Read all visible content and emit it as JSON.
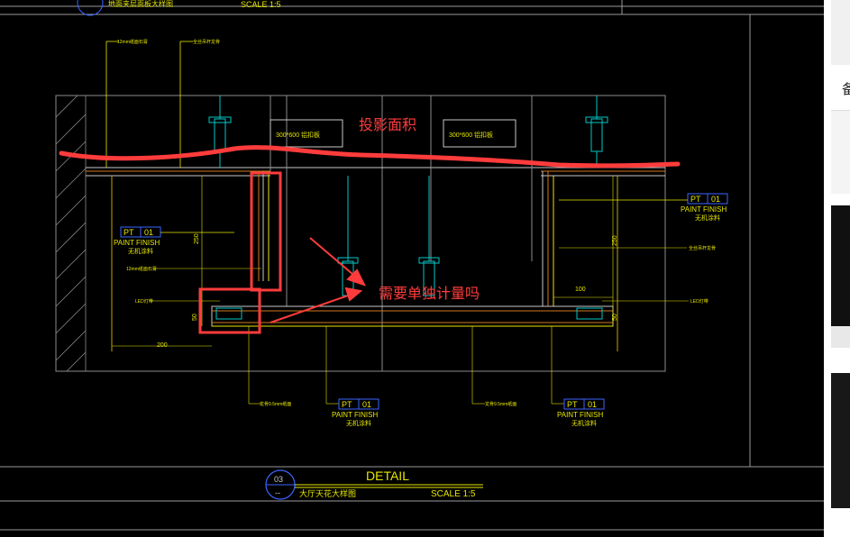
{
  "drawing": {
    "top_caption": "地面夹层面板大样图",
    "top_scale": "SCALE 1:5",
    "pt_tag": "PT",
    "pt_num": "01",
    "paint_finish": "PAINT FINISH",
    "paint_cn": "无机涂料",
    "label_12mm": "12mm纸面石膏",
    "label_hanger": "全丝吊杆龙骨",
    "label_led": "LED灯带",
    "label_board_left": "300*600 铝扣板",
    "label_board_right": "300*600 铝扣板",
    "label_bottom_a": "龙骨9.5mm纸面",
    "label_bottom_b": "龙骨9.5mm纸面",
    "dim_250": "250",
    "dim_50": "50",
    "dim_200": "200",
    "dim_100": "100"
  },
  "annotations": {
    "projection_area": "投影面积",
    "separate_question": "需要单独计量吗"
  },
  "title_block": {
    "number": "03",
    "dashes": "--",
    "detail": "DETAIL",
    "name": "大厅天花大样图",
    "scale": "SCALE 1:5"
  },
  "side_panel": {
    "glyph": "备"
  },
  "colors": {
    "background": "#000000",
    "cad_line": "#c8c8c8",
    "cyan": "#00c8c8",
    "yellow": "#e6e600",
    "blue": "#3c64ff",
    "orange": "#d2781e",
    "markup_red": "#ff3c3c"
  }
}
